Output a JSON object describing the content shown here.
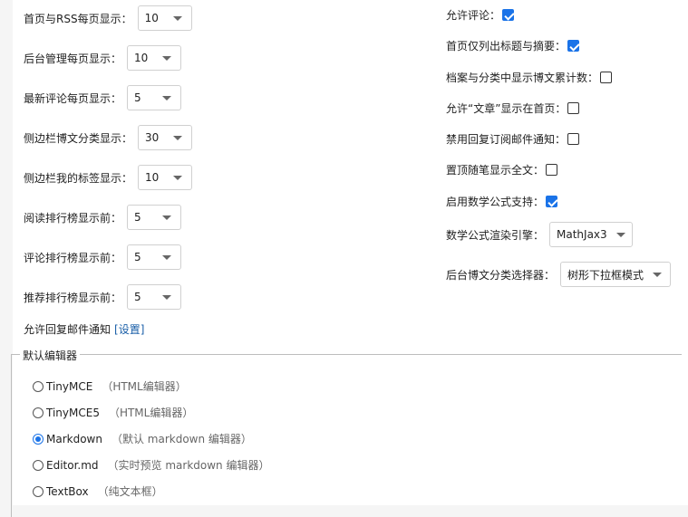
{
  "left_settings": [
    {
      "label": "首页与RSS每页显示：",
      "value": "10"
    },
    {
      "label": "后台管理每页显示：",
      "value": "10"
    },
    {
      "label": "最新评论每页显示：",
      "value": "5"
    },
    {
      "label": "侧边栏博文分类显示：",
      "value": "30"
    },
    {
      "label": "侧边栏我的标签显示：",
      "value": "10"
    },
    {
      "label": "阅读排行榜显示前：",
      "value": "5"
    },
    {
      "label": "评论排行榜显示前：",
      "value": "5"
    },
    {
      "label": "推荐排行榜显示前：",
      "value": "5"
    }
  ],
  "reply_notify": {
    "text": "允许回复邮件通知",
    "link": "[设置]"
  },
  "right_checkboxes": [
    {
      "label": "允许评论：",
      "checked": true
    },
    {
      "label": "首页仅列出标题与摘要：",
      "checked": true
    },
    {
      "label": "档案与分类中显示博文累计数：",
      "checked": false
    },
    {
      "label": "允许“文章”显示在首页：",
      "checked": false
    },
    {
      "label": "禁用回复订阅邮件通知：",
      "checked": false
    },
    {
      "label": "置顶随笔显示全文：",
      "checked": false
    },
    {
      "label": "启用数学公式支持：",
      "checked": true
    }
  ],
  "right_selects": [
    {
      "label": "数学公式渲染引擎：",
      "value": "MathJax3"
    },
    {
      "label": "后台博文分类选择器：",
      "value": "树形下拉框模式"
    }
  ],
  "editor": {
    "legend": "默认编辑器",
    "options": [
      {
        "name": "TinyMCE",
        "desc": "（HTML编辑器）",
        "selected": false
      },
      {
        "name": "TinyMCE5",
        "desc": "（HTML编辑器）",
        "selected": false
      },
      {
        "name": "Markdown",
        "desc": "（默认 markdown 编辑器）",
        "selected": true
      },
      {
        "name": "Editor.md",
        "desc": "（实时预览 markdown 编辑器）",
        "selected": false
      },
      {
        "name": "TextBox",
        "desc": "（纯文本框）",
        "selected": false
      }
    ]
  },
  "colors": {
    "accent": "#1a73e8",
    "link": "#1a5fa8"
  }
}
